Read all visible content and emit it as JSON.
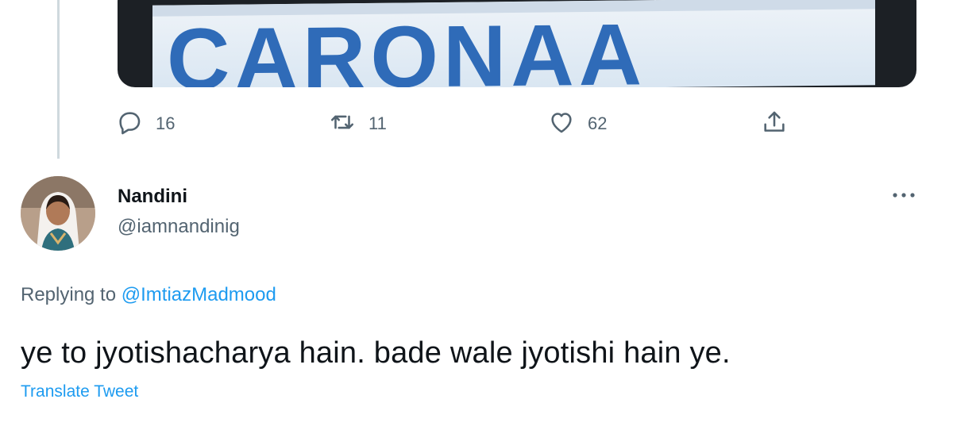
{
  "media": {
    "banner_text": "CARONAA"
  },
  "actions": {
    "reply": {
      "icon": "reply-icon",
      "count": "16"
    },
    "retweet": {
      "icon": "retweet-icon",
      "count": "11"
    },
    "like": {
      "icon": "heart-icon",
      "count": "62"
    },
    "share": {
      "icon": "share-icon"
    }
  },
  "tweet": {
    "author_name": "Nandini",
    "handle": "@iamnandinig",
    "more_icon": "more-icon",
    "replying_prefix": "Replying to",
    "replying_handle": "@ImtiazMadmood",
    "text": "ye to jyotishacharya hain. bade wale jyotishi hain ye.",
    "translate_label": "Translate Tweet"
  },
  "colors": {
    "accent": "#1d9bf0",
    "muted": "#536471",
    "text": "#0f1419",
    "thread_line": "#cfd9de"
  }
}
